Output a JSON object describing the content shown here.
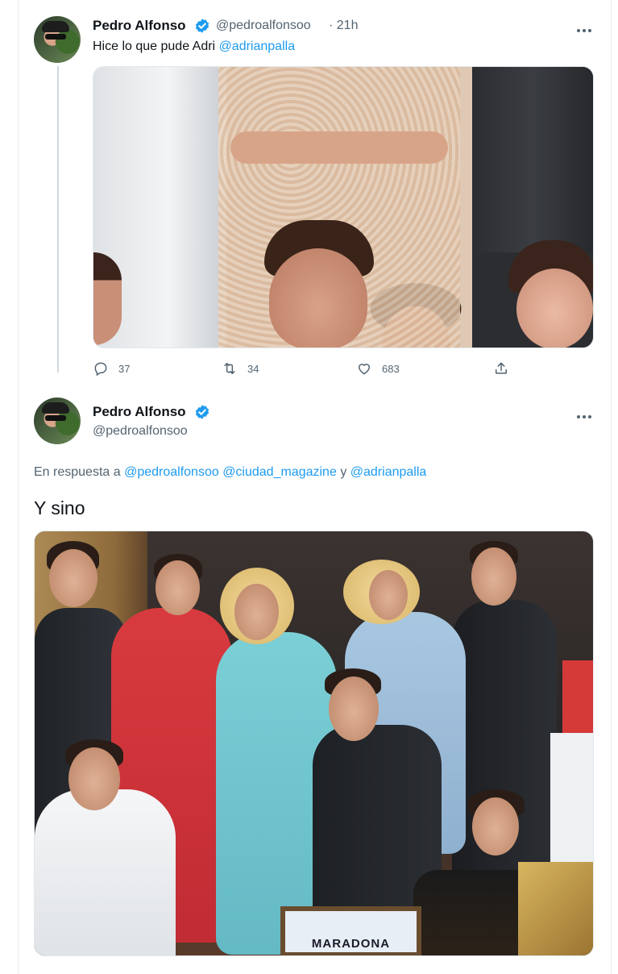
{
  "tweet1": {
    "author_name": "Pedro Alfonso",
    "author_handle": "@pedroalfonsoo",
    "time": "· 21h",
    "text": "Hice lo que pude Adri",
    "mention": "@adrianpalla",
    "stats": {
      "replies": "37",
      "retweets": "34",
      "likes": "683"
    }
  },
  "tweet2": {
    "author_name": "Pedro Alfonso",
    "author_handle": "@pedroalfonsoo",
    "reply_prefix": "En respuesta a",
    "reply_mention_1": "@pedroalfonsoo",
    "reply_mention_2": "@ciudad_magazine",
    "reply_and": "y",
    "reply_mention_3": "@adrianpalla",
    "text": "Y sino",
    "sign_text": "MARADONA"
  },
  "icons": [
    "verified-badge-icon",
    "more-icon",
    "reply-icon",
    "retweet-icon",
    "like-icon",
    "share-icon"
  ],
  "colors": {
    "accent": "#1d9bf0",
    "text": "#0f1419",
    "muted": "#536471"
  }
}
